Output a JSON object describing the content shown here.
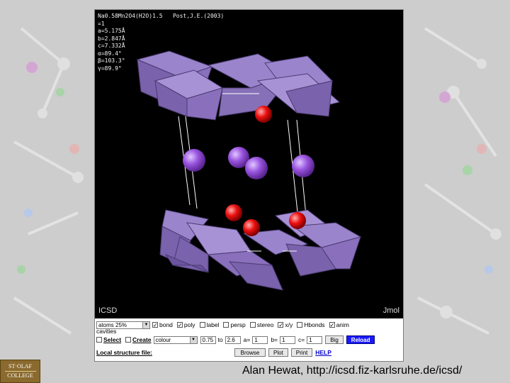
{
  "viewer": {
    "compound": "Na0.58Mn2O4(H2O)1.5   Post,J.E.(2003)",
    "params": [
      "=1",
      "a=5.175Å",
      "b=2.847Å",
      "c=7.332Å",
      "α=89.4°",
      "β=103.3°",
      "γ=89.9°"
    ],
    "watermark_left": "ICSD",
    "watermark_right": "Jmol"
  },
  "controls": {
    "atoms_select": "atoms 25%",
    "bond_label": "bond",
    "poly_label": "poly",
    "label_label": "label",
    "persp_label": "persp",
    "stereo_label": "stereo",
    "xyz_label": "x/y",
    "hbonds_label": "Hbonds",
    "anim_label": "anim",
    "cavities_label": "cavities",
    "select_label": "Select",
    "create_label": "Create",
    "colour_select": "colour",
    "range_from": "0.75",
    "to_label": "to",
    "range_to": "2.6",
    "a_label": "a=",
    "a_value": "1",
    "b_label": "b=",
    "b_value": "1",
    "c_label": "c=",
    "c_value": "1",
    "big_button": "Big",
    "reload_button": "Reload",
    "local_file_label": "Local structure file:",
    "browse_button": "Browse",
    "plot_button": "Plot",
    "print_button": "Print",
    "help_link": "HELP"
  },
  "footer": {
    "logo_top": "ST·OLAF",
    "logo_bottom": "COLLEGE",
    "credit": "Alan Hewat, http://icsd.fiz-karlsruhe.de/icsd/"
  },
  "colors": {
    "polyhedra": "#8a6fc0",
    "sodium": "#9a55e0",
    "oxygen": "#ee1111",
    "reload_button": "#1a1aff"
  }
}
